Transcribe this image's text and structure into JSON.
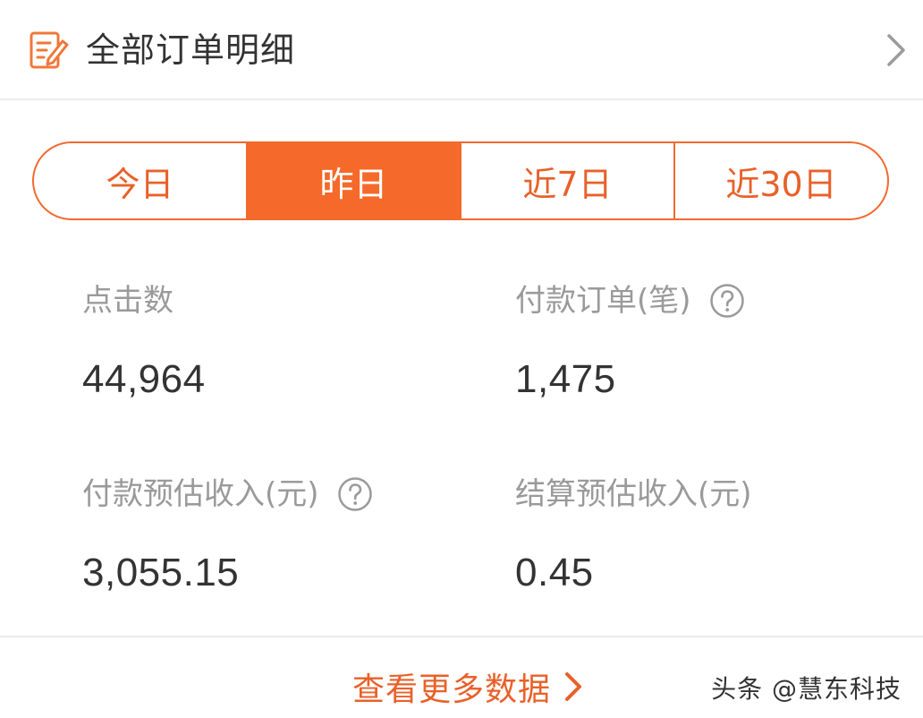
{
  "header": {
    "title": "全部订单明细",
    "icon": "order-edit-icon",
    "chevron_icon": "chevron-right-icon"
  },
  "tabs": [
    {
      "label": "今日",
      "active": false
    },
    {
      "label": "昨日",
      "active": true
    },
    {
      "label": "近7日",
      "active": false
    },
    {
      "label": "近30日",
      "active": false
    }
  ],
  "stats": {
    "clicks": {
      "label": "点击数",
      "value": "44,964"
    },
    "paid_orders": {
      "label": "付款订单(笔)",
      "value": "1,475",
      "help_icon": "question-circle-icon"
    },
    "paid_est_income": {
      "label": "付款预估收入(元)",
      "value": "3,055.15",
      "help_icon": "question-circle-icon"
    },
    "settle_est_income": {
      "label": "结算预估收入(元)",
      "value": "0.45"
    }
  },
  "footer": {
    "more_label": "查看更多数据",
    "more_icon": "chevron-right-icon"
  },
  "watermark": "头条 @慧东科技",
  "colors": {
    "accent": "#f56a2a",
    "accent_text": "#e8612a",
    "label_gray": "#9a9a9a",
    "value_dark": "#333333"
  }
}
